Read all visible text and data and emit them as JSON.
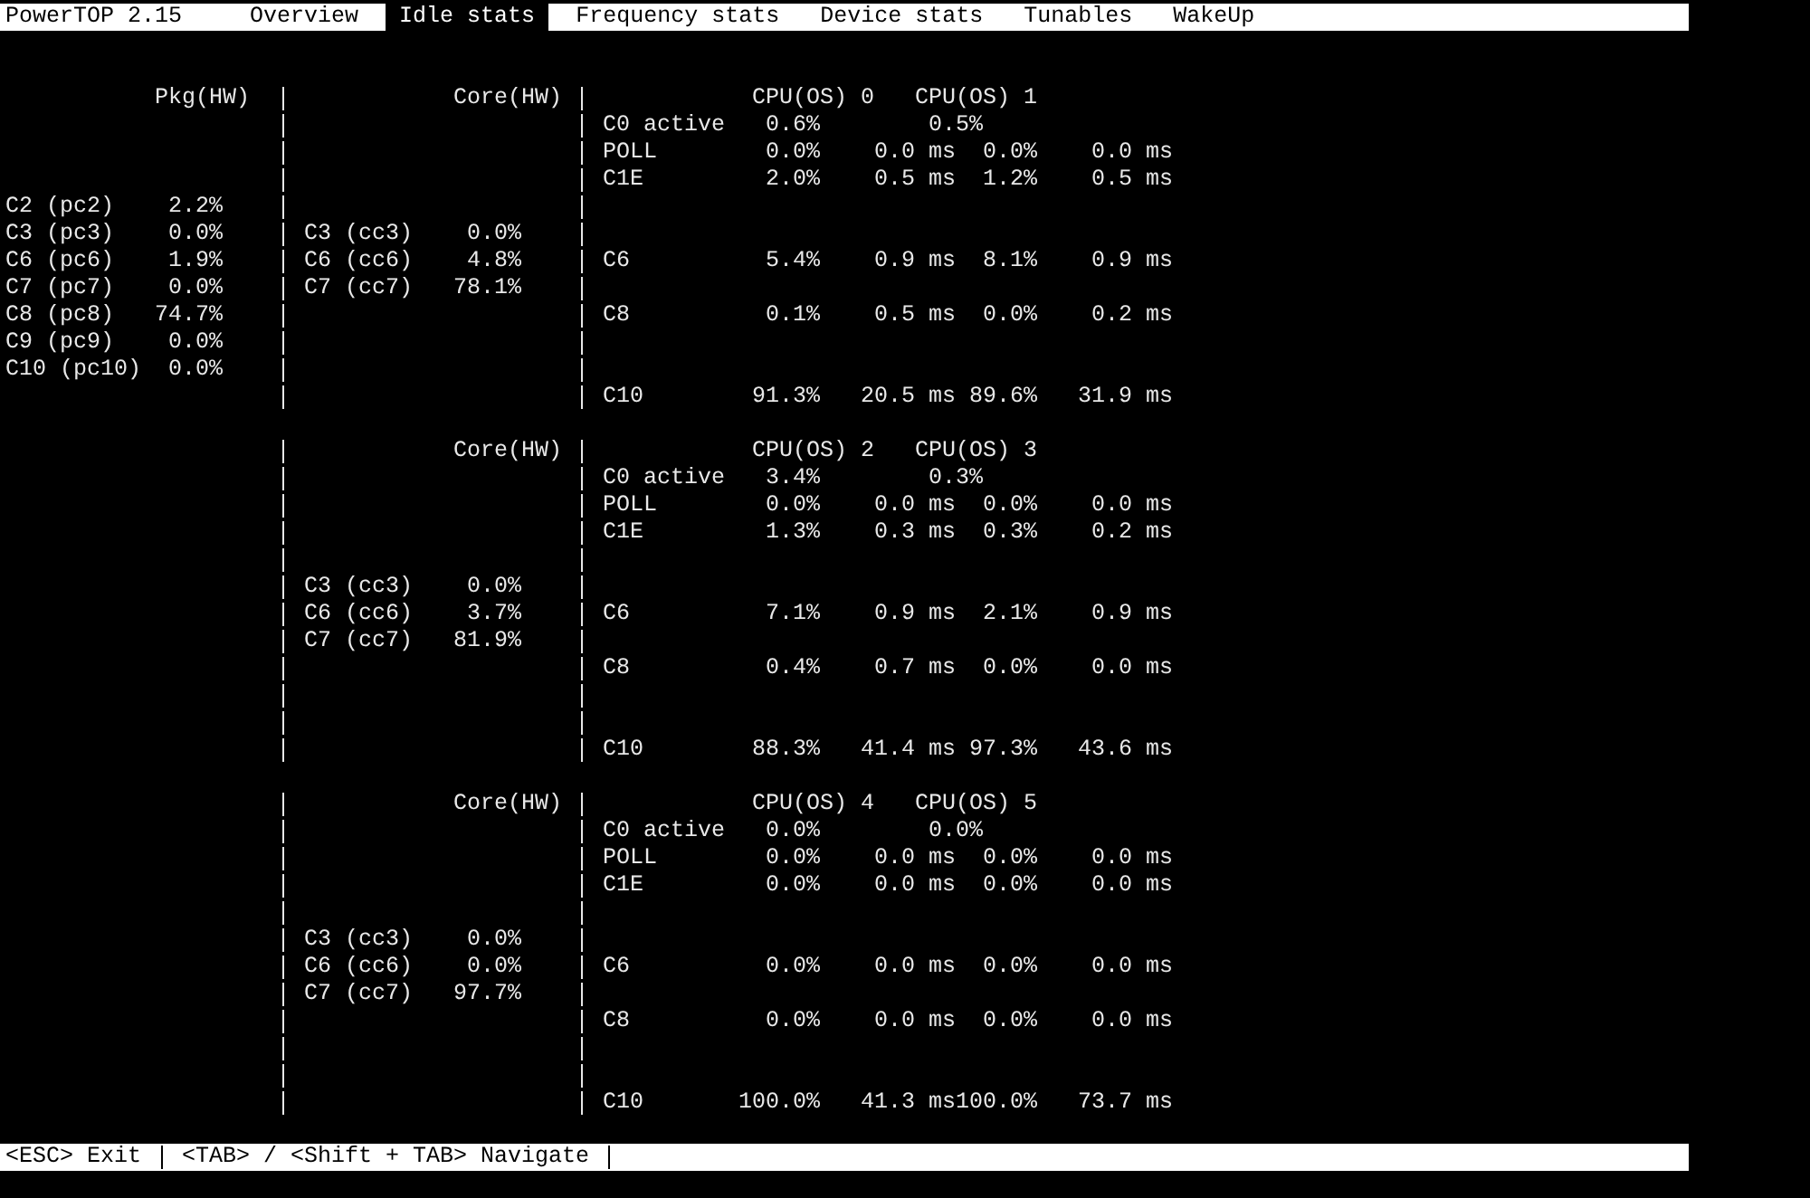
{
  "header": {
    "title": "PowerTOP 2.15",
    "tabs": [
      {
        "label": "Overview",
        "selected": false
      },
      {
        "label": "Idle stats",
        "selected": true
      },
      {
        "label": "Frequency stats",
        "selected": false
      },
      {
        "label": "Device stats",
        "selected": false
      },
      {
        "label": "Tunables",
        "selected": false
      },
      {
        "label": "WakeUp",
        "selected": false
      }
    ]
  },
  "blocks": [
    {
      "package_heading": "Pkg(HW)",
      "core_heading": "Core(HW)",
      "cpu_headings": [
        "CPU(OS) 0",
        "CPU(OS) 1"
      ],
      "lines": [
        {
          "kind": "stats",
          "cpu": {
            "kind": "active",
            "state": "C0 active",
            "cpus": [
              {
                "usage": "0.6%"
              },
              {
                "usage": "0.5%"
              }
            ]
          }
        },
        {
          "kind": "stats",
          "cpu": {
            "kind": "state",
            "state": "POLL",
            "cpus": [
              {
                "usage": "0.0%",
                "time": "0.0 ms"
              },
              {
                "usage": "0.0%",
                "time": "0.0 ms"
              }
            ]
          }
        },
        {
          "kind": "stats",
          "cpu": {
            "kind": "state",
            "state": "C1E",
            "cpus": [
              {
                "usage": "2.0%",
                "time": "0.5 ms"
              },
              {
                "usage": "1.2%",
                "time": "0.5 ms"
              }
            ]
          }
        },
        {
          "kind": "stats",
          "package": {
            "state": "C2 (pc2)",
            "usage": "2.2%"
          }
        },
        {
          "kind": "stats",
          "package": {
            "state": "C3 (pc3)",
            "usage": "0.0%"
          },
          "core": {
            "state": "C3 (cc3)",
            "usage": "0.0%"
          }
        },
        {
          "kind": "stats",
          "package": {
            "state": "C6 (pc6)",
            "usage": "1.9%"
          },
          "core": {
            "state": "C6 (cc6)",
            "usage": "4.8%"
          },
          "cpu": {
            "kind": "state",
            "state": "C6",
            "cpus": [
              {
                "usage": "5.4%",
                "time": "0.9 ms"
              },
              {
                "usage": "8.1%",
                "time": "0.9 ms"
              }
            ]
          }
        },
        {
          "kind": "stats",
          "package": {
            "state": "C7 (pc7)",
            "usage": "0.0%"
          },
          "core": {
            "state": "C7 (cc7)",
            "usage": "78.1%"
          }
        },
        {
          "kind": "stats",
          "package": {
            "state": "C8 (pc8)",
            "usage": "74.7%"
          },
          "cpu": {
            "kind": "state",
            "state": "C8",
            "cpus": [
              {
                "usage": "0.1%",
                "time": "0.5 ms"
              },
              {
                "usage": "0.0%",
                "time": "0.2 ms"
              }
            ]
          }
        },
        {
          "kind": "stats",
          "package": {
            "state": "C9 (pc9)",
            "usage": "0.0%"
          }
        },
        {
          "kind": "stats",
          "package": {
            "state": "C10 (pc10)",
            "usage": "0.0%"
          }
        },
        {
          "kind": "stats",
          "cpu": {
            "kind": "state",
            "state": "C10",
            "cpus": [
              {
                "usage": "91.3%",
                "time": "20.5 ms"
              },
              {
                "usage": "89.6%",
                "time": "31.9 ms"
              }
            ]
          }
        }
      ]
    },
    {
      "core_heading": "Core(HW)",
      "cpu_headings": [
        "CPU(OS) 2",
        "CPU(OS) 3"
      ],
      "lines": [
        {
          "kind": "stats",
          "cpu": {
            "kind": "active",
            "state": "C0 active",
            "cpus": [
              {
                "usage": "3.4%"
              },
              {
                "usage": "0.3%"
              }
            ]
          }
        },
        {
          "kind": "stats",
          "cpu": {
            "kind": "state",
            "state": "POLL",
            "cpus": [
              {
                "usage": "0.0%",
                "time": "0.0 ms"
              },
              {
                "usage": "0.0%",
                "time": "0.0 ms"
              }
            ]
          }
        },
        {
          "kind": "stats",
          "cpu": {
            "kind": "state",
            "state": "C1E",
            "cpus": [
              {
                "usage": "1.3%",
                "time": "0.3 ms"
              },
              {
                "usage": "0.3%",
                "time": "0.2 ms"
              }
            ]
          }
        },
        {
          "kind": "spacer"
        },
        {
          "kind": "stats",
          "core": {
            "state": "C3 (cc3)",
            "usage": "0.0%"
          }
        },
        {
          "kind": "stats",
          "core": {
            "state": "C6 (cc6)",
            "usage": "3.7%"
          },
          "cpu": {
            "kind": "state",
            "state": "C6",
            "cpus": [
              {
                "usage": "7.1%",
                "time": "0.9 ms"
              },
              {
                "usage": "2.1%",
                "time": "0.9 ms"
              }
            ]
          }
        },
        {
          "kind": "stats",
          "core": {
            "state": "C7 (cc7)",
            "usage": "81.9%"
          }
        },
        {
          "kind": "stats",
          "cpu": {
            "kind": "state",
            "state": "C8",
            "cpus": [
              {
                "usage": "0.4%",
                "time": "0.7 ms"
              },
              {
                "usage": "0.0%",
                "time": "0.0 ms"
              }
            ]
          }
        },
        {
          "kind": "spacer"
        },
        {
          "kind": "spacer"
        },
        {
          "kind": "stats",
          "cpu": {
            "kind": "state",
            "state": "C10",
            "cpus": [
              {
                "usage": "88.3%",
                "time": "41.4 ms"
              },
              {
                "usage": "97.3%",
                "time": "43.6 ms"
              }
            ]
          }
        }
      ]
    },
    {
      "core_heading": "Core(HW)",
      "cpu_headings": [
        "CPU(OS) 4",
        "CPU(OS) 5"
      ],
      "lines": [
        {
          "kind": "stats",
          "cpu": {
            "kind": "active",
            "state": "C0 active",
            "cpus": [
              {
                "usage": "0.0%"
              },
              {
                "usage": "0.0%"
              }
            ]
          }
        },
        {
          "kind": "stats",
          "cpu": {
            "kind": "state",
            "state": "POLL",
            "cpus": [
              {
                "usage": "0.0%",
                "time": "0.0 ms"
              },
              {
                "usage": "0.0%",
                "time": "0.0 ms"
              }
            ]
          }
        },
        {
          "kind": "stats",
          "cpu": {
            "kind": "state",
            "state": "C1E",
            "cpus": [
              {
                "usage": "0.0%",
                "time": "0.0 ms"
              },
              {
                "usage": "0.0%",
                "time": "0.0 ms"
              }
            ]
          }
        },
        {
          "kind": "spacer"
        },
        {
          "kind": "stats",
          "core": {
            "state": "C3 (cc3)",
            "usage": "0.0%"
          }
        },
        {
          "kind": "stats",
          "core": {
            "state": "C6 (cc6)",
            "usage": "0.0%"
          },
          "cpu": {
            "kind": "state",
            "state": "C6",
            "cpus": [
              {
                "usage": "0.0%",
                "time": "0.0 ms"
              },
              {
                "usage": "0.0%",
                "time": "0.0 ms"
              }
            ]
          }
        },
        {
          "kind": "stats",
          "core": {
            "state": "C7 (cc7)",
            "usage": "97.7%"
          }
        },
        {
          "kind": "stats",
          "cpu": {
            "kind": "state",
            "state": "C8",
            "cpus": [
              {
                "usage": "0.0%",
                "time": "0.0 ms"
              },
              {
                "usage": "0.0%",
                "time": "0.0 ms"
              }
            ]
          }
        },
        {
          "kind": "spacer"
        },
        {
          "kind": "spacer"
        },
        {
          "kind": "stats",
          "cpu": {
            "kind": "state",
            "state": "C10",
            "cpus": [
              {
                "usage": "100.0%",
                "time": "41.3 ms"
              },
              {
                "usage": "100.0%",
                "time": "73.7 ms"
              }
            ]
          }
        }
      ]
    }
  ],
  "footer": {
    "hints": [
      "<ESC> Exit",
      "<TAB> / <Shift + TAB> Navigate"
    ]
  }
}
